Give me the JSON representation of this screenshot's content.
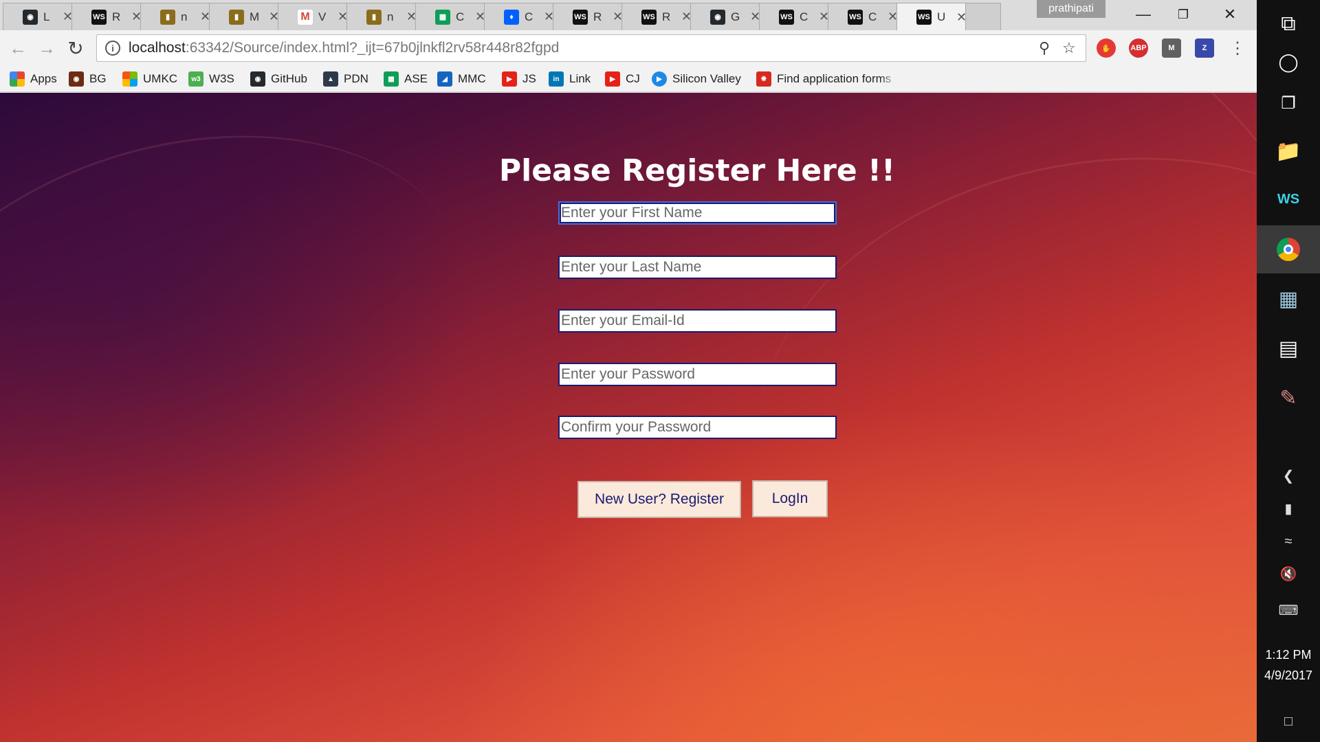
{
  "tabs": [
    {
      "title": "L",
      "icon": "github-icon"
    },
    {
      "title": "R",
      "icon": "webstorm-icon"
    },
    {
      "title": "n",
      "icon": "node-icon"
    },
    {
      "title": "M",
      "icon": "node-icon"
    },
    {
      "title": "V",
      "icon": "gmail-icon"
    },
    {
      "title": "n",
      "icon": "node-icon"
    },
    {
      "title": "C",
      "icon": "sheets-icon"
    },
    {
      "title": "C",
      "icon": "dropbox-icon"
    },
    {
      "title": "R",
      "icon": "webstorm-icon"
    },
    {
      "title": "R",
      "icon": "webstorm-icon"
    },
    {
      "title": "G",
      "icon": "github-icon"
    },
    {
      "title": "C",
      "icon": "webstorm-icon"
    },
    {
      "title": "C",
      "icon": "webstorm-icon"
    },
    {
      "title": "U",
      "icon": "webstorm-icon"
    }
  ],
  "active_tab_index": 13,
  "profile_name": "prathipati",
  "url": {
    "host": "localhost",
    "rest": ":63342/Source/index.html?_ijt=67b0jlnkfl2rv58r448r82fgpd"
  },
  "extensions": [
    {
      "name": "adblock-stop-icon",
      "label": ""
    },
    {
      "name": "abp-icon",
      "label": "ABP"
    },
    {
      "name": "extension-m-icon",
      "label": "M"
    },
    {
      "name": "extension-z-icon",
      "label": "Z"
    }
  ],
  "bookmarks": [
    {
      "label": "Apps",
      "icon": "apps-grid-icon"
    },
    {
      "label": "BG",
      "icon": "bg-icon"
    },
    {
      "label": "UMKC",
      "icon": "windows-logo-icon"
    },
    {
      "label": "W3S",
      "icon": "w3s-icon"
    },
    {
      "label": "GitHub",
      "icon": "github-icon"
    },
    {
      "label": "PDN",
      "icon": "pdn-icon"
    },
    {
      "label": "ASE",
      "icon": "sheets-icon"
    },
    {
      "label": "MMC",
      "icon": "mmc-icon"
    },
    {
      "label": "JS",
      "icon": "youtube-icon"
    },
    {
      "label": "Link",
      "icon": "linkedin-icon"
    },
    {
      "label": "CJ",
      "icon": "youtube-icon"
    },
    {
      "label": "Silicon Valley",
      "icon": "play-circle-icon"
    },
    {
      "label": "Find application forms",
      "icon": "maple-leaf-icon"
    }
  ],
  "form": {
    "title": "Please Register Here !!",
    "first_name_placeholder": "Enter your First Name",
    "last_name_placeholder": "Enter your Last Name",
    "email_placeholder": "Enter your Email-Id",
    "password_placeholder": "Enter your Password",
    "confirm_password_placeholder": "Confirm your Password",
    "register_label": "New User? Register",
    "login_label": "LogIn"
  },
  "clock": {
    "time": "1:12 PM",
    "date": "4/9/2017"
  },
  "colors": {
    "button_bg": "#fbe9dc",
    "button_text": "#1a1a6e",
    "field_border": "#1a1a6e",
    "title_text": "#ffffff"
  }
}
